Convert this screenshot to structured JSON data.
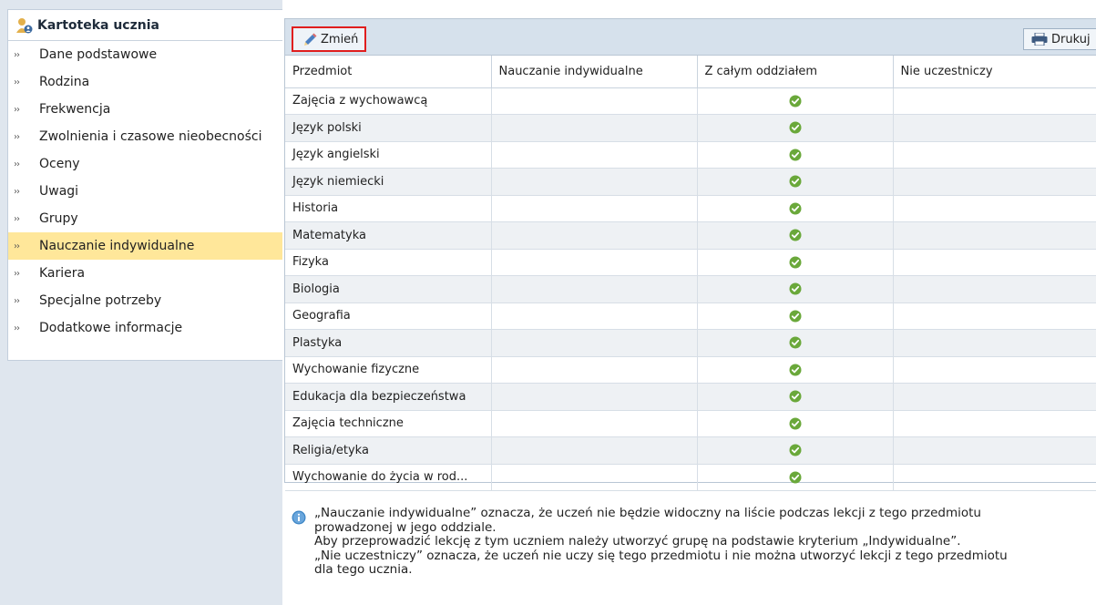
{
  "sidebar": {
    "title": "Kartoteka ucznia",
    "items": [
      {
        "label": "Dane podstawowe"
      },
      {
        "label": "Rodzina"
      },
      {
        "label": "Frekwencja"
      },
      {
        "label": "Zwolnienia i czasowe nieobecności"
      },
      {
        "label": "Oceny"
      },
      {
        "label": "Uwagi"
      },
      {
        "label": "Grupy"
      },
      {
        "label": "Nauczanie indywidualne",
        "active": true
      },
      {
        "label": "Kariera"
      },
      {
        "label": "Specjalne potrzeby"
      },
      {
        "label": "Dodatkowe informacje"
      }
    ]
  },
  "toolbar": {
    "change_label": "Zmień",
    "print_label": "Drukuj"
  },
  "table": {
    "columns": [
      "Przedmiot",
      "Nauczanie indywidualne",
      "Z całym oddziałem",
      "Nie uczestniczy"
    ],
    "rows": [
      {
        "subject": "Zajęcia z wychowawcą",
        "individual": false,
        "whole_class": true,
        "not_participating": false
      },
      {
        "subject": "Język polski",
        "individual": false,
        "whole_class": true,
        "not_participating": false
      },
      {
        "subject": "Język angielski",
        "individual": false,
        "whole_class": true,
        "not_participating": false
      },
      {
        "subject": "Język niemiecki",
        "individual": false,
        "whole_class": true,
        "not_participating": false
      },
      {
        "subject": "Historia",
        "individual": false,
        "whole_class": true,
        "not_participating": false
      },
      {
        "subject": "Matematyka",
        "individual": false,
        "whole_class": true,
        "not_participating": false
      },
      {
        "subject": "Fizyka",
        "individual": false,
        "whole_class": true,
        "not_participating": false
      },
      {
        "subject": "Biologia",
        "individual": false,
        "whole_class": true,
        "not_participating": false
      },
      {
        "subject": "Geografia",
        "individual": false,
        "whole_class": true,
        "not_participating": false
      },
      {
        "subject": "Plastyka",
        "individual": false,
        "whole_class": true,
        "not_participating": false
      },
      {
        "subject": "Wychowanie fizyczne",
        "individual": false,
        "whole_class": true,
        "not_participating": false
      },
      {
        "subject": "Edukacja dla bezpieczeństwa",
        "individual": false,
        "whole_class": true,
        "not_participating": false
      },
      {
        "subject": "Zajęcia techniczne",
        "individual": false,
        "whole_class": true,
        "not_participating": false
      },
      {
        "subject": "Religia/etyka",
        "individual": false,
        "whole_class": true,
        "not_participating": false
      },
      {
        "subject": "Wychowanie do życia w rod...",
        "individual": false,
        "whole_class": true,
        "not_participating": false
      }
    ]
  },
  "info": {
    "lines": [
      "„Nauczanie indywidualne” oznacza, że uczeń nie będzie widoczny na liście podczas lekcji z tego przedmiotu",
      "prowadzonej w jego oddziale.",
      "Aby przeprowadzić lekcję z tym uczniem należy utworzyć grupę na podstawie kryterium „Indywidualne”.",
      "„Nie uczestniczy” oznacza, że uczeń nie uczy się tego przedmiotu i nie można utworzyć lekcji z tego przedmiotu",
      "dla tego ucznia."
    ]
  },
  "colors": {
    "active_item": "#ffe79a",
    "toolbar": "#d6e1ec",
    "check_green": "#6aa83a",
    "highlight_border": "#e01e1e",
    "info_blue": "#3d86c6"
  },
  "icons": {
    "header": "student-card-icon",
    "change": "pencil-icon",
    "print": "printer-icon",
    "check": "check-circle-icon",
    "info": "info-icon",
    "item": "double-chevron-icon"
  }
}
